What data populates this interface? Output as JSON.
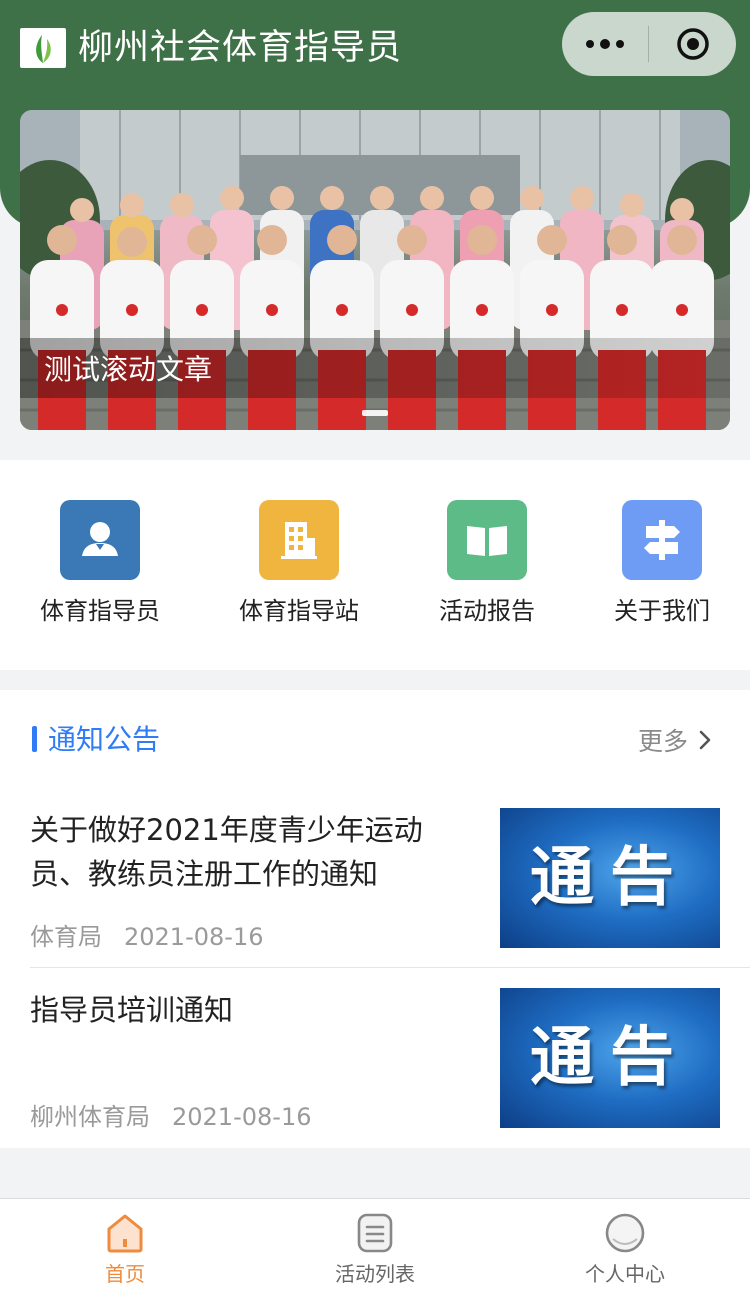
{
  "header": {
    "title": "柳州社会体育指导员"
  },
  "capsule": {
    "more_icon": "more-dots-icon",
    "close_icon": "target-circle-icon"
  },
  "banner": {
    "caption": "测试滚动文章",
    "indicator_count": 1
  },
  "menu": [
    {
      "label": "体育指导员",
      "icon": "person-icon",
      "color": "#3a78b6"
    },
    {
      "label": "体育指导站",
      "icon": "building-icon",
      "color": "#efb53e"
    },
    {
      "label": "活动报告",
      "icon": "book-icon",
      "color": "#5dbb88"
    },
    {
      "label": "关于我们",
      "icon": "signpost-icon",
      "color": "#6e9cf4"
    }
  ],
  "notices": {
    "title": "通知公告",
    "more_label": "更多",
    "items": [
      {
        "title": "关于做好2021年度青少年运动员、教练员注册工作的通知",
        "source": "体育局",
        "date": "2021-08-16",
        "thumb_text": "通告"
      },
      {
        "title": "指导员培训通知",
        "source": "柳州体育局",
        "date": "2021-08-16",
        "thumb_text": "通告"
      }
    ]
  },
  "tabbar": [
    {
      "label": "首页",
      "icon": "home-icon",
      "active": true
    },
    {
      "label": "活动列表",
      "icon": "list-icon",
      "active": false
    },
    {
      "label": "个人中心",
      "icon": "profile-icon",
      "active": false
    }
  ],
  "colors": {
    "header_green": "#3f7148",
    "accent_blue": "#2f7cf6",
    "tab_active": "#f08a3c",
    "tab_inactive": "#666666"
  }
}
